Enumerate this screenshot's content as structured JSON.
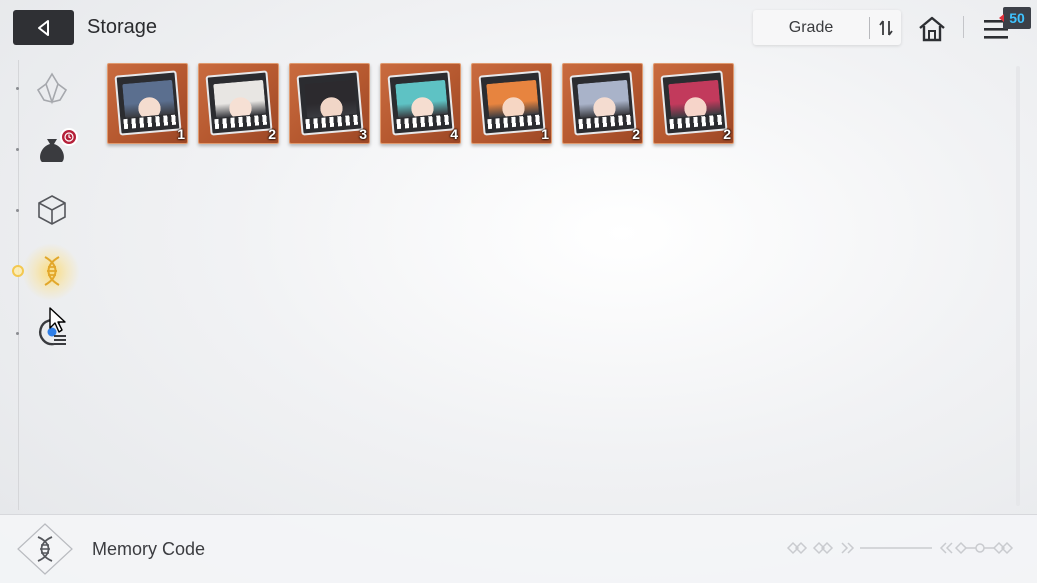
{
  "header": {
    "title": "Storage",
    "sort": {
      "label": "Grade"
    },
    "menu_badge": "50"
  },
  "sidebar": {
    "items": [
      {
        "icon": "crystal-icon",
        "active": false
      },
      {
        "icon": "pouch-icon",
        "active": false,
        "has_notification": true
      },
      {
        "icon": "cube-icon",
        "active": false
      },
      {
        "icon": "dna-icon",
        "active": true
      },
      {
        "icon": "target-list-icon",
        "active": false
      }
    ]
  },
  "items": [
    {
      "count": "1",
      "hair": "#5b6f8f",
      "skin": "#f4dccf"
    },
    {
      "count": "2",
      "hair": "#e8e6e3",
      "skin": "#f6e0d4"
    },
    {
      "count": "3",
      "hair": "#2c2a2e",
      "skin": "#f1d6c7"
    },
    {
      "count": "4",
      "hair": "#5ec2c4",
      "skin": "#f5ddd0"
    },
    {
      "count": "1",
      "hair": "#e7843f",
      "skin": "#f6d6c3"
    },
    {
      "count": "2",
      "hair": "#a9b3c9",
      "skin": "#f4dcd0"
    },
    {
      "count": "2",
      "hair": "#c23a5c",
      "skin": "#f6d4c9"
    }
  ],
  "footer": {
    "label": "Memory Code"
  }
}
